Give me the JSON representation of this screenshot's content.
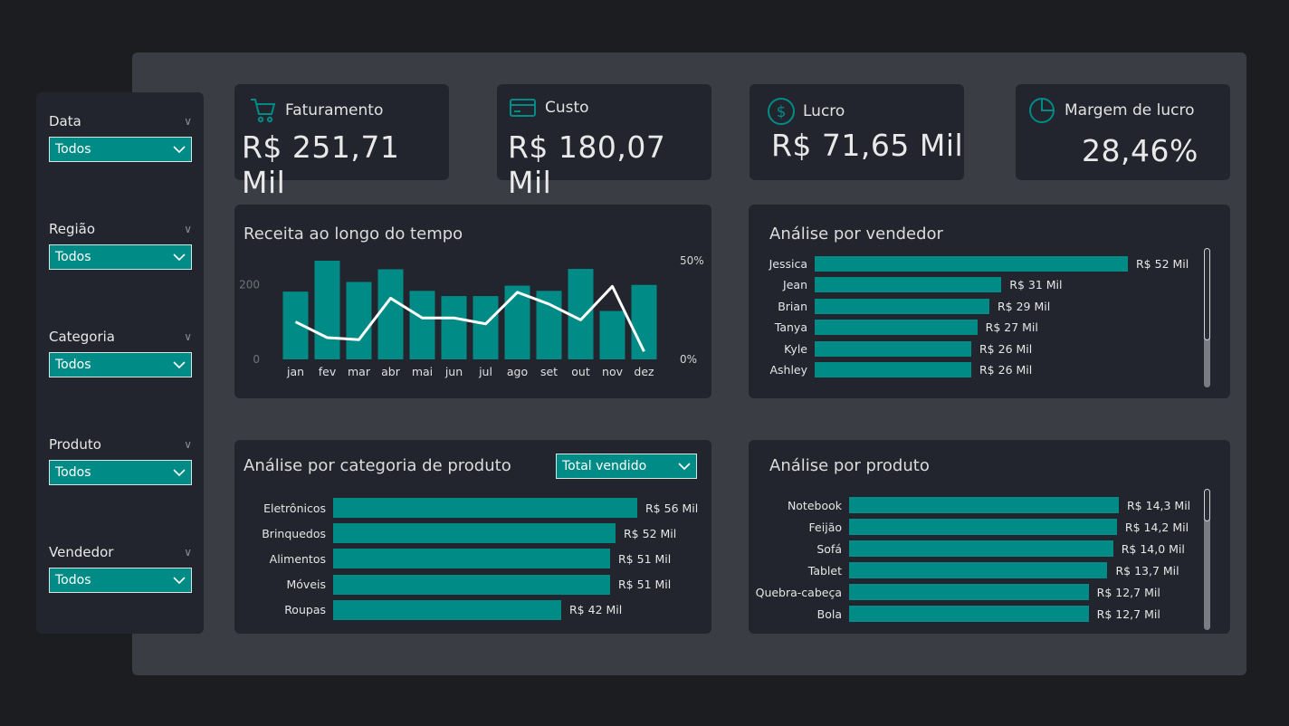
{
  "filters": [
    {
      "label": "Data",
      "value": "Todos"
    },
    {
      "label": "Região",
      "value": "Todos"
    },
    {
      "label": "Categoria",
      "value": "Todos"
    },
    {
      "label": "Produto",
      "value": "Todos"
    },
    {
      "label": "Vendedor",
      "value": "Todos"
    }
  ],
  "kpis": [
    {
      "title": "Faturamento",
      "value": "R$ 251,71 Mil",
      "icon": "cart-icon"
    },
    {
      "title": "Custo",
      "value": "R$ 180,07 Mil",
      "icon": "credit-card-icon"
    },
    {
      "title": "Lucro",
      "value": "R$ 71,65 Mil",
      "icon": "dollar-circle-icon"
    },
    {
      "title": "Margem de lucro",
      "value": "28,46%",
      "icon": "pie-chart-icon"
    }
  ],
  "colors": {
    "accent": "#008b87",
    "panel": "#22252d",
    "canvas": "#3a3d44",
    "line": "#ffffff"
  },
  "revenue_chart": {
    "title": "Receita ao longo do tempo",
    "chart_data": {
      "type": "bar",
      "categories": [
        "jan",
        "fev",
        "mar",
        "abr",
        "mai",
        "jun",
        "jul",
        "ago",
        "set",
        "out",
        "nov",
        "dez"
      ],
      "series": [
        {
          "values": [
            182,
            265,
            208,
            242,
            184,
            170,
            170,
            198,
            184,
            243,
            130,
            200
          ]
        },
        {
          "values": [
            19,
            11,
            10,
            31,
            21,
            21,
            18,
            34,
            28,
            20,
            37,
            4
          ]
        }
      ],
      "ylim": [
        0,
        265
      ],
      "y_ticks": [
        "0",
        "200"
      ],
      "y2lim": [
        0,
        50
      ],
      "y2_ticks": [
        "0%",
        "50%"
      ]
    }
  },
  "vendor_chart": {
    "title": "Análise por vendedor",
    "chart_data": {
      "type": "bar",
      "categories": [
        "Jessica",
        "Jean",
        "Brian",
        "Tanya",
        "Kyle",
        "Ashley"
      ],
      "values": [
        52,
        31,
        29,
        27,
        26,
        26
      ],
      "labels": [
        "R$ 52 Mil",
        "R$ 31 Mil",
        "R$ 29 Mil",
        "R$ 27 Mil",
        "R$ 26 Mil",
        "R$ 26 Mil"
      ]
    }
  },
  "category_chart": {
    "title": "Análise por categoria de produto",
    "dropdown": "Total vendido",
    "chart_data": {
      "type": "bar",
      "categories": [
        "Eletrônicos",
        "Brinquedos",
        "Alimentos",
        "Móveis",
        "Roupas"
      ],
      "values": [
        56,
        52,
        51,
        51,
        42
      ],
      "labels": [
        "R$ 56 Mil",
        "R$ 52 Mil",
        "R$ 51 Mil",
        "R$ 51 Mil",
        "R$ 42 Mil"
      ]
    }
  },
  "product_chart": {
    "title": "Análise por produto",
    "chart_data": {
      "type": "bar",
      "categories": [
        "Notebook",
        "Feijão",
        "Sofá",
        "Tablet",
        "Quebra-cabeça",
        "Bola"
      ],
      "values": [
        14.3,
        14.2,
        14.0,
        13.7,
        12.7,
        12.7
      ],
      "labels": [
        "R$ 14,3 Mil",
        "R$ 14,2 Mil",
        "R$ 14,0 Mil",
        "R$ 13,7 Mil",
        "R$ 12,7 Mil",
        "R$ 12,7 Mil"
      ]
    }
  }
}
